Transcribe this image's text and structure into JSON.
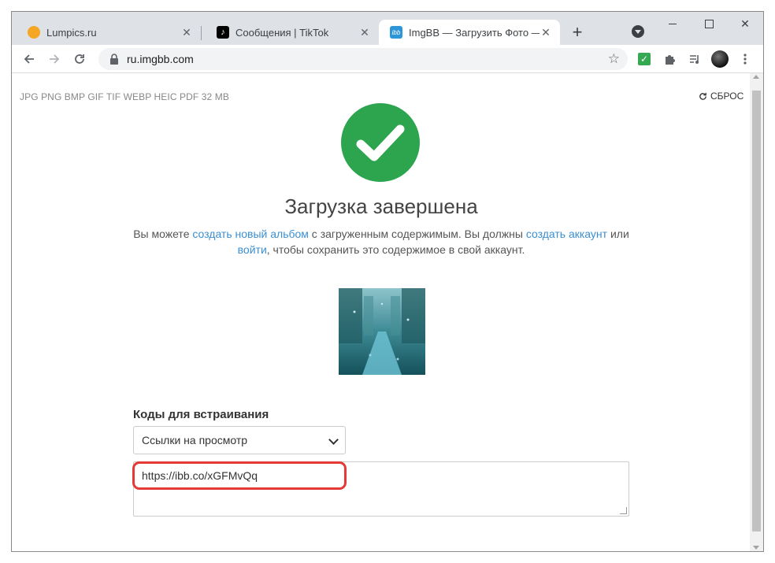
{
  "browser": {
    "tabs": [
      {
        "title": "Lumpics.ru",
        "favicon": "lumpics-favicon",
        "color": "#f5a623",
        "active": false
      },
      {
        "title": "Сообщения | TikTok",
        "favicon": "tiktok-favicon",
        "color": "#000000",
        "active": false
      },
      {
        "title": "ImgBB — Загрузить Фото — Х",
        "favicon": "imgbb-favicon",
        "favicon_text": "ibb",
        "color": "#2d96d8",
        "active": true
      }
    ],
    "new_tab_symbol": "+",
    "url": "ru.imgbb.com"
  },
  "page": {
    "formats": "JPG PNG BMP GIF TIF WEBP HEIC PDF  32 MB",
    "reset_label": "СБРОС",
    "heading": "Загрузка завершена",
    "desc": {
      "part1": "Вы можете ",
      "link_album": "создать новый альбом",
      "part2": " с загруженным содержимым. Вы должны ",
      "link_create_account": "создать аккаунт",
      "part3": " или ",
      "link_login": "войти",
      "part4": ", чтобы сохранить это содержимое в свой аккаунт."
    },
    "embed_label": "Коды для встраивания",
    "select_value": "Ссылки на просмотр",
    "embed_code": "https://ibb.co/xGFMvQq"
  },
  "colors": {
    "success": "#2da44e",
    "link": "#3b8fd1",
    "highlight": "#e53935"
  }
}
